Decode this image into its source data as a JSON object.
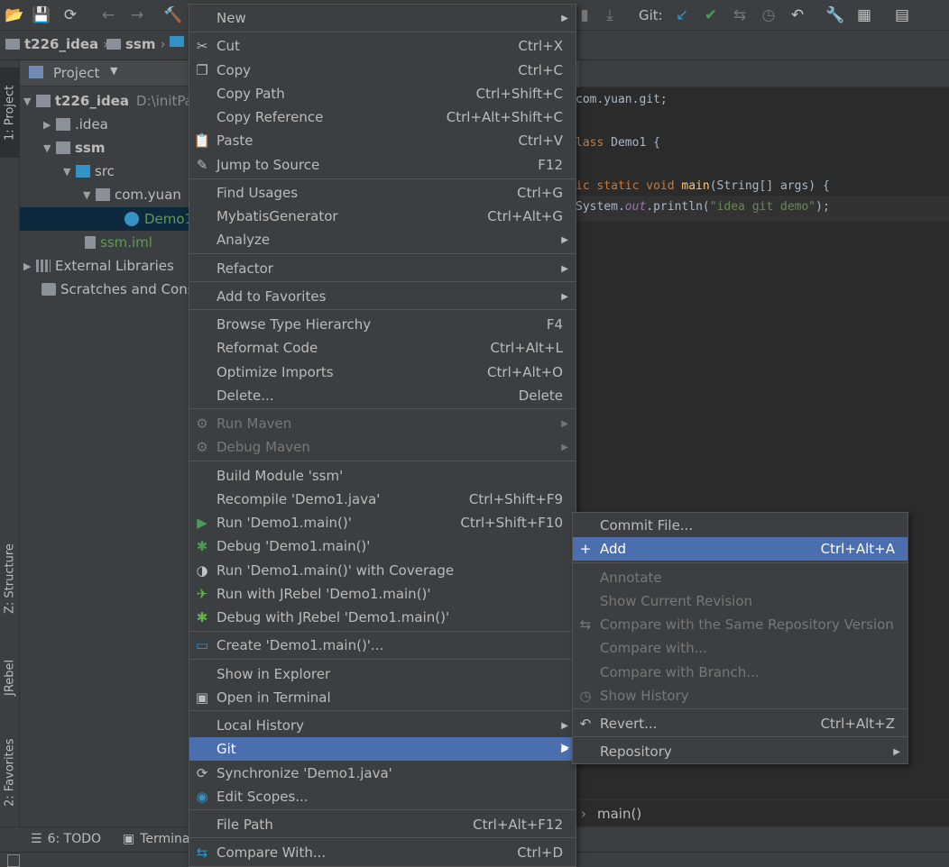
{
  "colors": {
    "menu_bg": "#3c3f41",
    "highlight": "#4b6eaf",
    "disabled_text": "#777777",
    "text": "#bbbbbb",
    "git_check": "#3592c4",
    "git_commit": "#499c54",
    "selection": "#0d293e"
  },
  "toolbar": {
    "git_label": "Git:",
    "icons": [
      "open-folder-icon",
      "save-icon",
      "sync-icon",
      "back-icon",
      "forward-icon",
      "build-hammer-icon",
      "git-update-icon",
      "git-commit-icon",
      "git-compare-icon",
      "git-history-icon",
      "git-revert-icon",
      "settings-wrench-icon",
      "project-structure-icon",
      "sdk-manager-icon"
    ]
  },
  "breadcrumb": [
    "t226_idea",
    "ssm",
    ""
  ],
  "left_stripe": {
    "project_tab": "1: Project",
    "structure_tab": "Z: Structure",
    "jrebel_tab": "JRebel",
    "favorites_tab": "2: Favorites"
  },
  "project_panel": {
    "title": "Project",
    "tree": [
      {
        "label": "t226_idea",
        "path": "D:\\initPa",
        "bold": true
      },
      {
        "label": ".idea"
      },
      {
        "label": "ssm",
        "bold": true
      },
      {
        "label": "src"
      },
      {
        "label": "com.yuan"
      },
      {
        "label": "Demo1"
      },
      {
        "label": "ssm.iml"
      },
      {
        "label": "External Libraries"
      },
      {
        "label": "Scratches and Cons"
      }
    ]
  },
  "editor": {
    "line1": "com.yuan.git;",
    "line2_kw": "lass",
    "line2_rest": " Demo1 {",
    "line3_kw": "ic static void ",
    "line3_fn": "main",
    "line3_rest": "(String[] args) {",
    "line4_a": "System.",
    "line4_b": "out",
    "line4_c": ".println(",
    "line4_d": "\"idea git demo\"",
    "line4_e": ");",
    "footer_crumb": "main()"
  },
  "bottom_tabs": {
    "todo": "6: TODO",
    "terminal": "Termina"
  },
  "context_menu": {
    "items": [
      {
        "label": "New",
        "shortcut": "",
        "sub": true
      },
      {
        "label": "Cut",
        "shortcut": "Ctrl+X",
        "icon": "scissors-icon"
      },
      {
        "label": "Copy",
        "shortcut": "Ctrl+C",
        "icon": "copy-icon"
      },
      {
        "label": "Copy Path",
        "shortcut": "Ctrl+Shift+C"
      },
      {
        "label": "Copy Reference",
        "shortcut": "Ctrl+Alt+Shift+C"
      },
      {
        "label": "Paste",
        "shortcut": "Ctrl+V",
        "icon": "paste-icon"
      },
      {
        "label": "Jump to Source",
        "shortcut": "F12",
        "icon": "pencil-icon"
      },
      {
        "label": "Find Usages",
        "shortcut": "Ctrl+G"
      },
      {
        "label": "MybatisGenerator",
        "shortcut": "Ctrl+Alt+G"
      },
      {
        "label": "Analyze",
        "shortcut": "",
        "sub": true
      },
      {
        "label": "Refactor",
        "shortcut": "",
        "sub": true
      },
      {
        "label": "Add to Favorites",
        "shortcut": "",
        "sub": true
      },
      {
        "label": "Browse Type Hierarchy",
        "shortcut": "F4"
      },
      {
        "label": "Reformat Code",
        "shortcut": "Ctrl+Alt+L"
      },
      {
        "label": "Optimize Imports",
        "shortcut": "Ctrl+Alt+O"
      },
      {
        "label": "Delete...",
        "shortcut": "Delete"
      },
      {
        "label": "Run Maven",
        "shortcut": "",
        "sub": true,
        "disabled": true,
        "icon": "gear-icon"
      },
      {
        "label": "Debug Maven",
        "shortcut": "",
        "sub": true,
        "disabled": true,
        "icon": "gear-icon"
      },
      {
        "label": "Build Module 'ssm'",
        "shortcut": ""
      },
      {
        "label": "Recompile 'Demo1.java'",
        "shortcut": "Ctrl+Shift+F9"
      },
      {
        "label": "Run 'Demo1.main()'",
        "shortcut": "Ctrl+Shift+F10",
        "icon": "run-icon"
      },
      {
        "label": "Debug 'Demo1.main()'",
        "shortcut": "",
        "icon": "debug-bug-icon"
      },
      {
        "label": "Run 'Demo1.main()' with Coverage",
        "shortcut": "",
        "icon": "coverage-icon"
      },
      {
        "label": "Run with JRebel 'Demo1.main()'",
        "shortcut": "",
        "icon": "jrebel-run-icon"
      },
      {
        "label": "Debug with JRebel 'Demo1.main()'",
        "shortcut": "",
        "icon": "jrebel-debug-icon"
      },
      {
        "label": "Create 'Demo1.main()'...",
        "shortcut": "",
        "icon": "create-config-icon"
      },
      {
        "label": "Show in Explorer",
        "shortcut": ""
      },
      {
        "label": "Open in Terminal",
        "shortcut": "",
        "icon": "terminal-icon"
      },
      {
        "label": "Local History",
        "shortcut": "",
        "sub": true
      },
      {
        "label": "Git",
        "shortcut": "",
        "sub": true,
        "highlighted": true
      },
      {
        "label": "Synchronize 'Demo1.java'",
        "shortcut": "",
        "icon": "sync-icon"
      },
      {
        "label": "Edit Scopes...",
        "shortcut": "",
        "icon": "scope-icon"
      },
      {
        "label": "File Path",
        "shortcut": "Ctrl+Alt+F12"
      },
      {
        "label": "Compare With...",
        "shortcut": "Ctrl+D",
        "icon": "compare-icon"
      }
    ]
  },
  "git_submenu": {
    "items": [
      {
        "label": "Commit File...",
        "shortcut": ""
      },
      {
        "label": "Add",
        "shortcut": "Ctrl+Alt+A",
        "icon": "plus-icon",
        "highlighted": true
      },
      {
        "label": "Annotate",
        "shortcut": "",
        "disabled": true
      },
      {
        "label": "Show Current Revision",
        "shortcut": "",
        "disabled": true
      },
      {
        "label": "Compare with the Same Repository Version",
        "shortcut": "",
        "disabled": true,
        "icon": "compare-icon"
      },
      {
        "label": "Compare with...",
        "shortcut": "",
        "disabled": true
      },
      {
        "label": "Compare with Branch...",
        "shortcut": "",
        "disabled": true
      },
      {
        "label": "Show History",
        "shortcut": "",
        "disabled": true,
        "icon": "clock-icon"
      },
      {
        "label": "Revert...",
        "shortcut": "Ctrl+Alt+Z",
        "icon": "revert-icon"
      },
      {
        "label": "Repository",
        "shortcut": "",
        "sub": true
      }
    ]
  }
}
